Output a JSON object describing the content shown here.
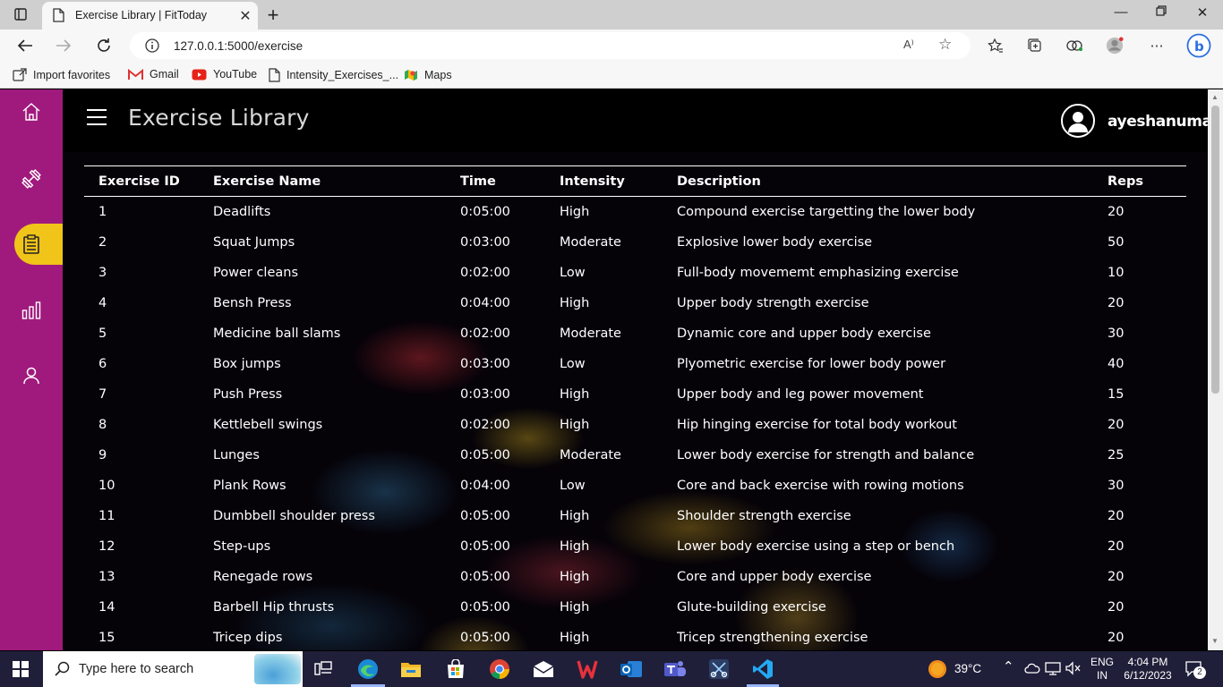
{
  "browser": {
    "tab_title": "Exercise Library | FitToday",
    "url": "127.0.0.1:5000/exercise",
    "read_aloud": "A⁾",
    "bookmarks": [
      "Import favorites",
      "Gmail",
      "YouTube",
      "Intensity_Exercises_...",
      "Maps"
    ]
  },
  "header": {
    "title": "Exercise Library",
    "username": "ayeshanuma"
  },
  "sidebar": {
    "items": [
      "home-icon",
      "dumbbell-icon",
      "clipboard-icon",
      "bar-chart-icon",
      "user-icon"
    ],
    "active_index": 2,
    "colors": {
      "background": "#a01a7d",
      "active": "#f0c419"
    }
  },
  "table": {
    "columns": [
      "Exercise ID",
      "Exercise Name",
      "Time",
      "Intensity",
      "Description",
      "Reps"
    ],
    "rows": [
      [
        "1",
        "Deadlifts",
        "0:05:00",
        "High",
        "Compound exercise targetting the lower body",
        "20"
      ],
      [
        "2",
        "Squat Jumps",
        "0:03:00",
        "Moderate",
        "Explosive lower body exercise",
        "50"
      ],
      [
        "3",
        "Power cleans",
        "0:02:00",
        "Low",
        "Full-body movememt emphasizing exercise",
        "10"
      ],
      [
        "4",
        "Bensh Press",
        "0:04:00",
        "High",
        "Upper body strength exercise",
        "20"
      ],
      [
        "5",
        "Medicine ball slams",
        "0:02:00",
        "Moderate",
        "Dynamic core and upper body exercise",
        "30"
      ],
      [
        "6",
        "Box jumps",
        "0:03:00",
        "Low",
        "Plyometric exercise for lower body power",
        "40"
      ],
      [
        "7",
        "Push Press",
        "0:03:00",
        "High",
        "Upper body and leg power movement",
        "15"
      ],
      [
        "8",
        "Kettlebell swings",
        "0:02:00",
        "High",
        "Hip hinging exercise for total body workout",
        "20"
      ],
      [
        "9",
        "Lunges",
        "0:05:00",
        "Moderate",
        "Lower body exercise for strength and balance",
        "25"
      ],
      [
        "10",
        "Plank Rows",
        "0:04:00",
        "Low",
        "Core and back exercise with rowing motions",
        "30"
      ],
      [
        "11",
        "Dumbbell shoulder press",
        "0:05:00",
        "High",
        "Shoulder strength exercise",
        "20"
      ],
      [
        "12",
        "Step-ups",
        "0:05:00",
        "High",
        "Lower body exercise using a step or bench",
        "20"
      ],
      [
        "13",
        "Renegade rows",
        "0:05:00",
        "High",
        "Core and upper body exercise",
        "20"
      ],
      [
        "14",
        "Barbell Hip thrusts",
        "0:05:00",
        "High",
        "Glute-building exercise",
        "20"
      ],
      [
        "15",
        "Tricep dips",
        "0:05:00",
        "High",
        "Tricep strengthening exercise",
        "20"
      ]
    ]
  },
  "taskbar": {
    "search_placeholder": "Type here to search",
    "weather": "39°C",
    "language": "ENG",
    "region": "IN",
    "time": "4:04 PM",
    "date": "6/12/2023",
    "notifications": "2"
  }
}
